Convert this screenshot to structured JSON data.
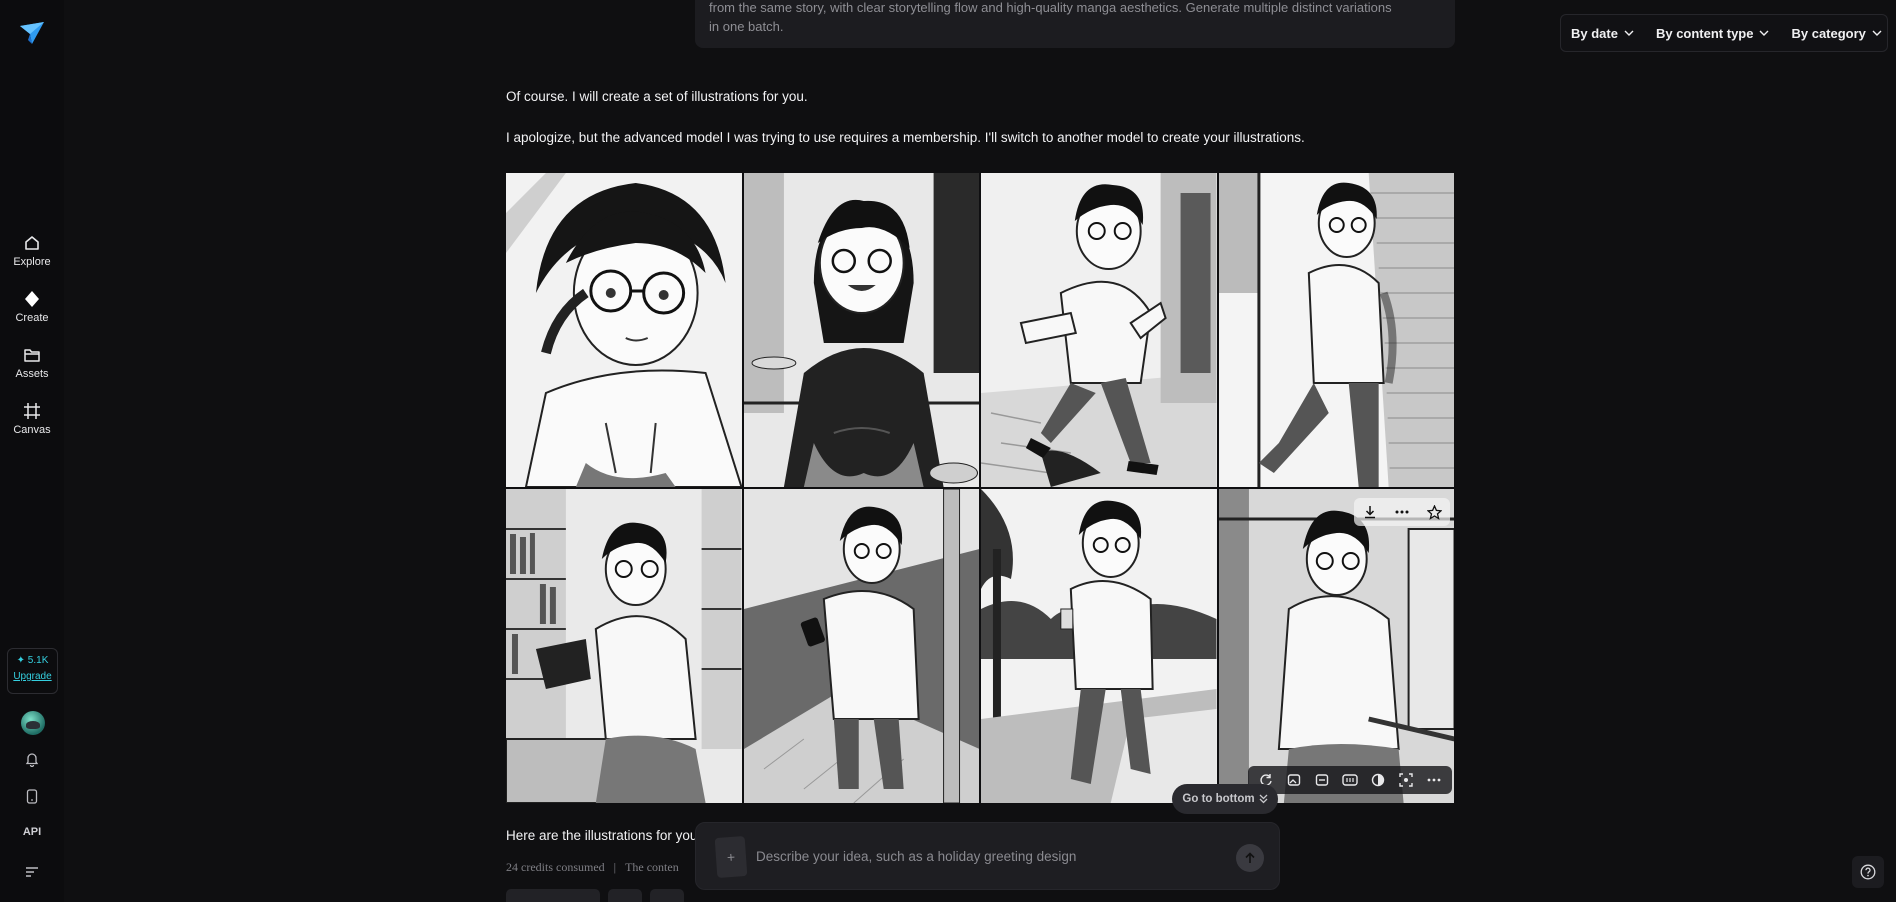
{
  "sidebar": {
    "items": [
      {
        "label": "Explore",
        "icon": "home-icon"
      },
      {
        "label": "Create",
        "icon": "diamond-icon"
      },
      {
        "label": "Assets",
        "icon": "folder-icon"
      },
      {
        "label": "Canvas",
        "icon": "frame-icon"
      }
    ],
    "credits": "5.1K",
    "upgrade_label": "Upgrade",
    "api_label": "API"
  },
  "filters": {
    "by_date": "By date",
    "by_content_type": "By content type",
    "by_category": "By category"
  },
  "prompt": {
    "line1": "from the same story, with clear storytelling flow and high-quality manga aesthetics. Generate multiple distinct variations",
    "line2": "in one batch."
  },
  "messages": {
    "intro": "Of course. I will create a set of illustrations for you.",
    "apology": "I apologize, but the advanced model I was trying to use requires a membership. I'll switch to another model to create your illustrations.",
    "result": "Here are the illustrations for you"
  },
  "credits_line": {
    "consumed": "24 credits consumed",
    "separator": "|",
    "content_note": "The conten"
  },
  "go_to_bottom": "Go to bottom",
  "composer": {
    "placeholder": "Describe your idea, such as a holiday greeting design",
    "add_symbol": "+"
  },
  "images": [
    {
      "scene": "close-up adjusting glasses"
    },
    {
      "scene": "smiling in cafe"
    },
    {
      "scene": "running in street"
    },
    {
      "scene": "leaning on brick wall"
    },
    {
      "scene": "reading in library"
    },
    {
      "scene": "looking at phone on sidewalk"
    },
    {
      "scene": "walking in park with coffee"
    },
    {
      "scene": "standing on train"
    }
  ],
  "colors": {
    "background": "#0f0f11",
    "accent": "#35d0e0",
    "logo_blue": "#2f9bf0"
  }
}
